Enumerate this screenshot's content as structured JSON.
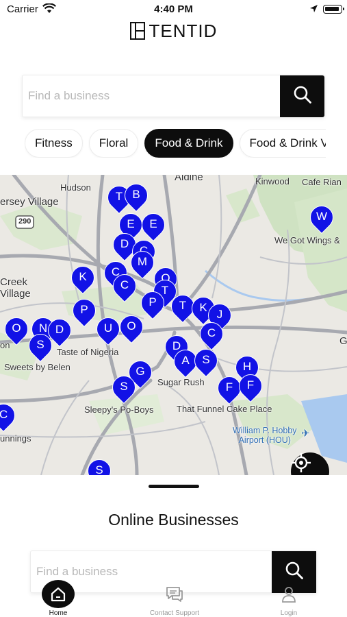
{
  "status_bar": {
    "carrier": "Carrier",
    "time": "4:40 PM"
  },
  "brand": {
    "name": "TENTID"
  },
  "search": {
    "placeholder": "Find a business"
  },
  "categories": [
    {
      "label": "Fitness",
      "active": false
    },
    {
      "label": "Floral",
      "active": false
    },
    {
      "label": "Food & Drink",
      "active": true
    },
    {
      "label": "Food & Drink V",
      "active": false
    }
  ],
  "map": {
    "labels": {
      "aldine": "Aldine",
      "hudson": "Hudson",
      "jersey_village": "ersey Village",
      "kinwood": "Kinwood",
      "cafe_rian": "Cafe Rian",
      "we_got_wings": "We Got Wings &",
      "creek_village": "Creek\nVillage",
      "taste_of_nigeria": "Taste of Nigeria",
      "sweets_by_belen": "Sweets by Belen",
      "sugar_rush": "Sugar Rush",
      "sleepys": "Sleepy's Po-Boys",
      "funnel_cake": "That Funnel Cake Place",
      "hobby_airport": "William P. Hobby\nAirport (HOU)",
      "cunnings": "unnings",
      "on": "on",
      "g_edge": "G",
      "route_290": "290"
    },
    "marker_color": "#1212e6",
    "pins": [
      "T",
      "B",
      "E",
      "E",
      "D",
      "C",
      "M",
      "W",
      "K",
      "C",
      "C",
      "O",
      "T",
      "P",
      "T",
      "K",
      "J",
      "P",
      "O",
      "N",
      "D",
      "U",
      "O",
      "C",
      "D",
      "S",
      "A",
      "S",
      "H",
      "G",
      "S",
      "F",
      "F",
      "C",
      "S"
    ]
  },
  "sheet": {
    "title": "Online Businesses",
    "search_placeholder": "Find a business"
  },
  "tabs": [
    {
      "label": "Home",
      "active": true
    },
    {
      "label": "Contact Support",
      "active": false
    },
    {
      "label": "Login",
      "active": false
    }
  ]
}
